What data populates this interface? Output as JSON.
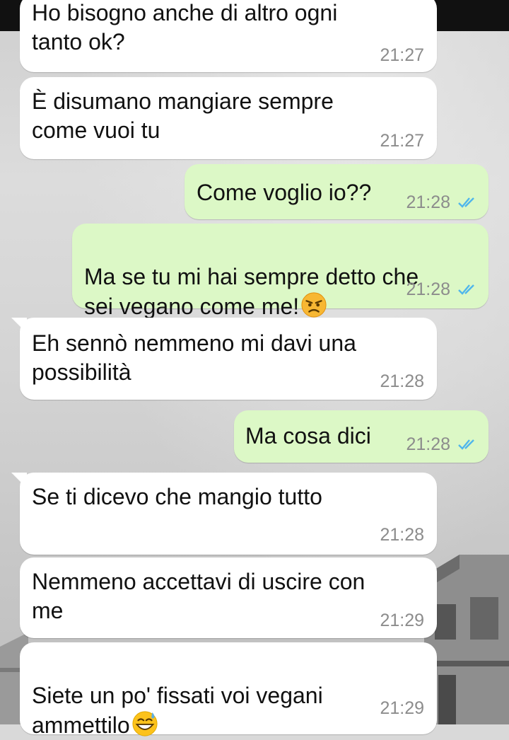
{
  "messages": [
    {
      "id": "m1",
      "dir": "in",
      "text": "Ho bisogno anche di altro ogni\ntanto ok?",
      "time": "21:27"
    },
    {
      "id": "m2",
      "dir": "in",
      "text": "È disumano mangiare sempre\ncome vuoi tu",
      "time": "21:27"
    },
    {
      "id": "m3",
      "dir": "out",
      "text": "Come voglio io??",
      "time": "21:28",
      "status": "read"
    },
    {
      "id": "m4",
      "dir": "out",
      "text": "Ma se tu mi hai sempre detto che\nsei vegano come me!",
      "emoji": "angry-face",
      "time": "21:28",
      "status": "read"
    },
    {
      "id": "m5",
      "dir": "in",
      "text": "Eh sennò nemmeno mi davi una\npossibilità",
      "time": "21:28"
    },
    {
      "id": "m6",
      "dir": "out",
      "text": "Ma cosa dici",
      "time": "21:28",
      "status": "read"
    },
    {
      "id": "m7",
      "dir": "in",
      "text": "Se ti dicevo che mangio tutto",
      "time": "21:28"
    },
    {
      "id": "m8",
      "dir": "in",
      "text": "Nemmeno accettavi di uscire con\nme",
      "time": "21:29"
    },
    {
      "id": "m9",
      "dir": "in",
      "text": "Siete un po' fissati voi vegani\nammettilo",
      "emoji": "grinning-sweat-face",
      "time": "21:29"
    }
  ],
  "colors": {
    "incoming": "#ffffff",
    "outgoing": "#dcf8c6",
    "read_ticks": "#4fb6ec",
    "timestamp": "#8c8c8c"
  }
}
